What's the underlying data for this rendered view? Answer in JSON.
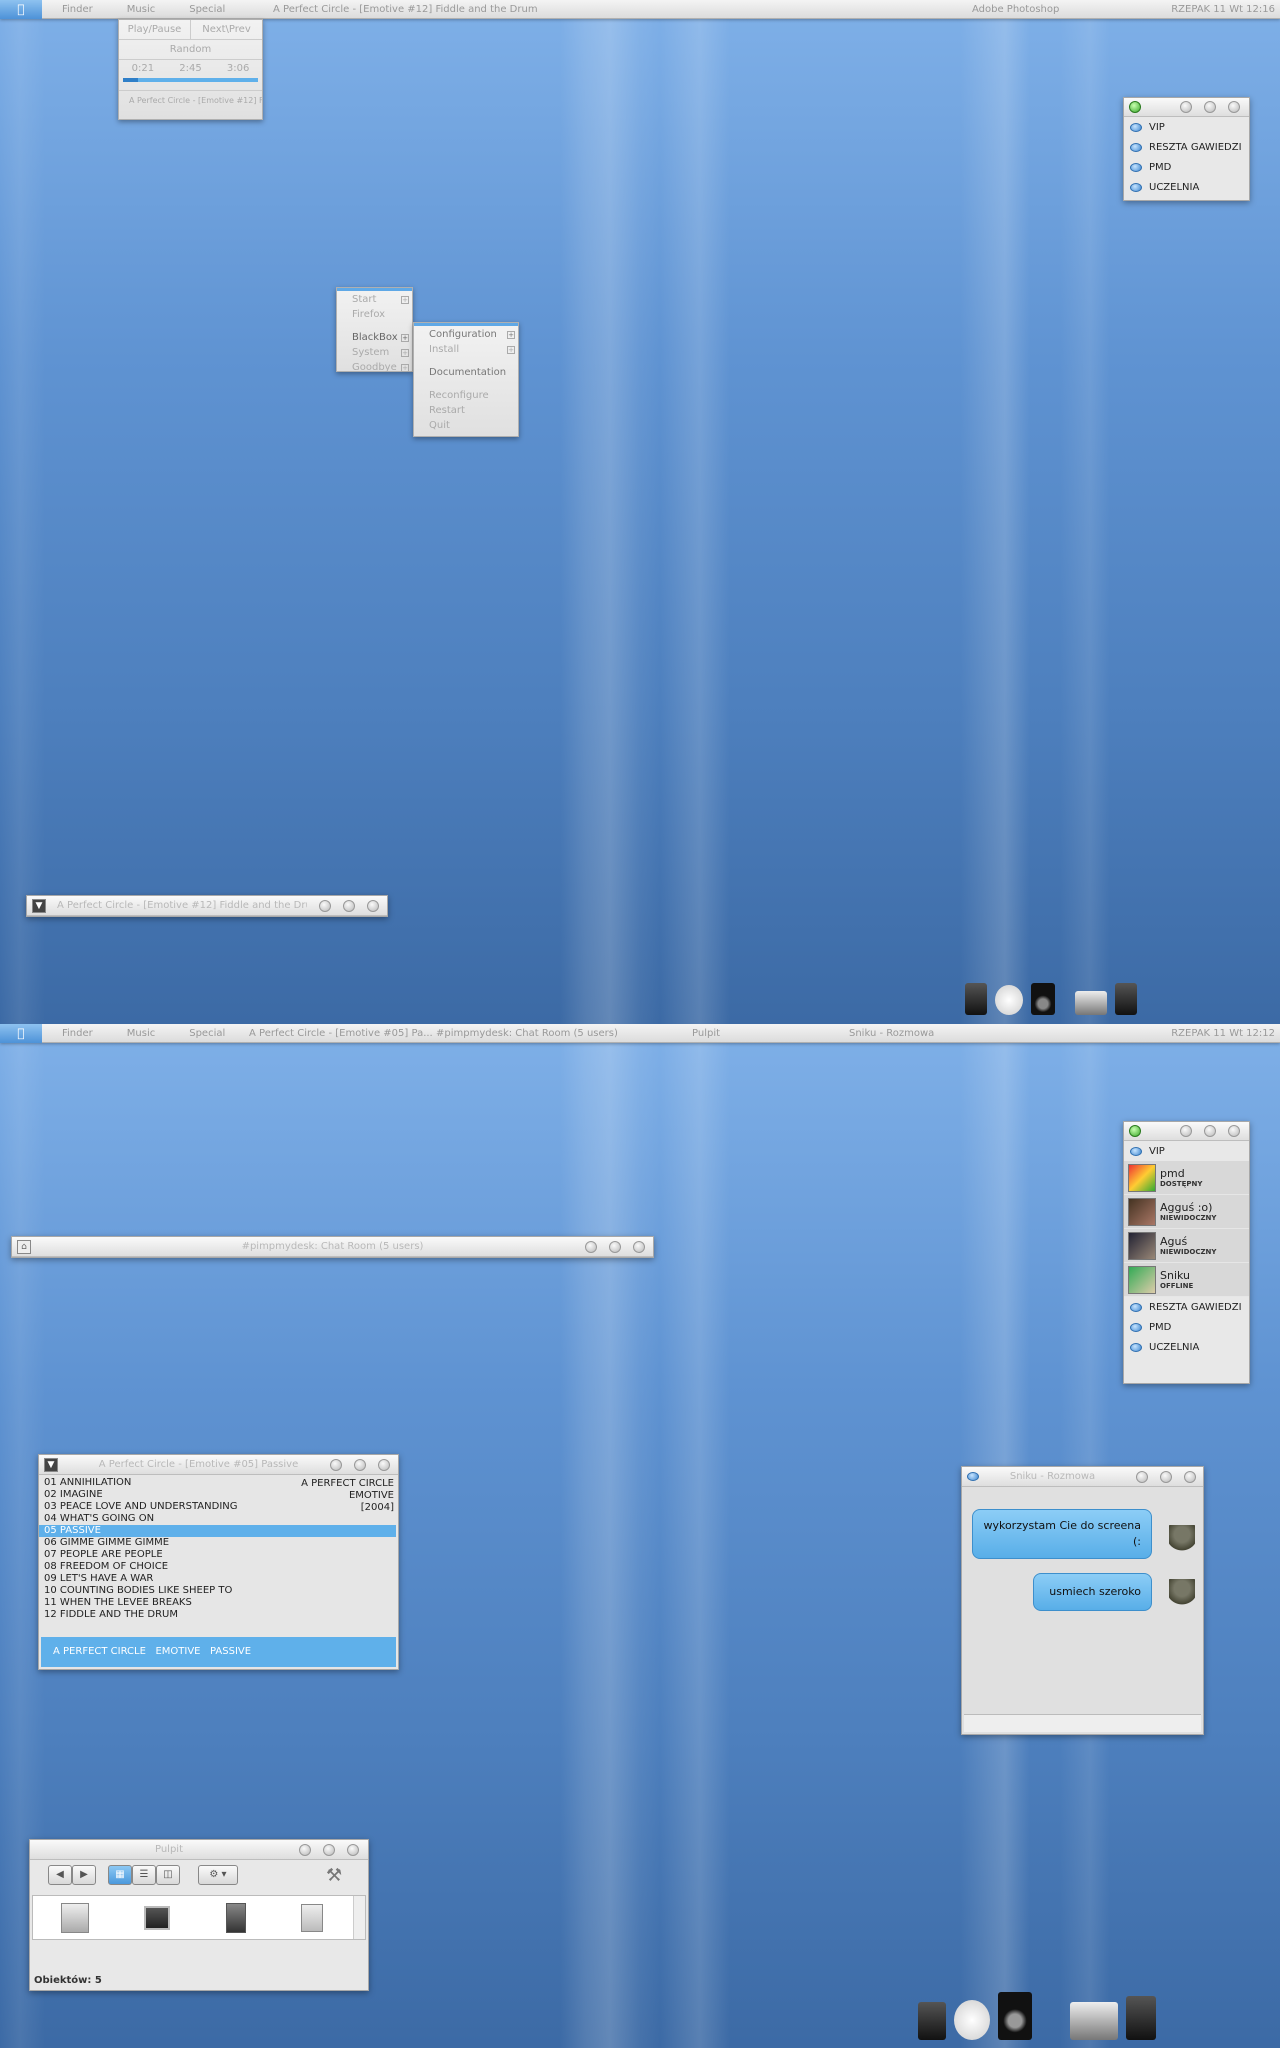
{
  "screen1": {
    "menubar": {
      "apple": "",
      "items": [
        "Finder",
        "Music",
        "Special"
      ],
      "title": "A Perfect Circle - [Emotive #12] Fiddle and the Drum",
      "app": "Adobe Photoshop",
      "clock": "RZEPAK 11 Wt 12:16"
    },
    "music_menu": {
      "play": "Play/Pause",
      "next": "Next\\Prev",
      "random": "Random",
      "t1": "0:21",
      "t2": "2:45",
      "t3": "3:06",
      "progress": 0.11,
      "now": "A Perfect Circle - [Emotive #12] Fiddle and the Drum"
    },
    "root_menu": {
      "items": [
        "Start",
        "Firefox",
        "BlackBox",
        "System",
        "Goodbye"
      ]
    },
    "blackbox_menu": {
      "items": [
        "Configuration",
        "Install",
        "Documentation",
        "Reconfigure",
        "Restart",
        "Quit"
      ]
    },
    "buddy": {
      "groups": [
        "VIP",
        "RESZTA GAWIEDZI",
        "PMD",
        "UCZELNIA"
      ]
    },
    "player_title": "A Perfect Circle - [Emotive #12] Fiddle and the Drum"
  },
  "screen2": {
    "menubar": {
      "items": [
        "Finder",
        "Music",
        "Special"
      ],
      "tasks": [
        "A Perfect Circle - [Emotive #05] Pa...",
        "#pimpmydesk: Chat Room (5 users)",
        "Pulpit",
        "Sniku - Rozmowa"
      ],
      "clock": "RZEPAK 11 Wt 12:12"
    },
    "chatroom_title": "#pimpmydesk: Chat Room (5 users)",
    "buddy": {
      "vip": "VIP",
      "contacts": [
        {
          "name": "pmd",
          "status": "DOSTĘPNY"
        },
        {
          "name": "Agguś :o)",
          "status": "NIEWIDOCZNY"
        },
        {
          "name": "Aguś",
          "status": "NIEWIDOCZNY"
        },
        {
          "name": "Sniku",
          "status": "OFFLINE"
        }
      ],
      "groups": [
        "RESZTA GAWIEDZI",
        "PMD",
        "UCZELNIA"
      ]
    },
    "player": {
      "title": "A Perfect Circle - [Emotive #05] Passive",
      "tracks": [
        "01  ANNIHILATION",
        "02  IMAGINE",
        "03  PEACE LOVE AND UNDERSTANDING",
        "04  WHAT'S GOING ON",
        "05  PASSIVE",
        "06  GIMME GIMME GIMME",
        "07  PEOPLE ARE PEOPLE",
        "08  FREEDOM OF CHOICE",
        "09  LET'S HAVE A WAR",
        "10  COUNTING BODIES LIKE SHEEP TO",
        "11  WHEN THE LEVEE BREAKS",
        "12  FIDDLE AND THE DRUM"
      ],
      "artist": "A PERFECT CIRCLE",
      "album": "EMOTIVE",
      "year": "[2004]",
      "footer": "A PERFECT CIRCLE   EMOTIVE   PASSIVE"
    },
    "chat": {
      "title": "Sniku - Rozmowa",
      "msg1": "wykorzystam Cie do screena (:",
      "msg2": "usmiech szeroko"
    },
    "finder": {
      "title": "Pulpit",
      "status": "Obiektów: 5"
    }
  }
}
